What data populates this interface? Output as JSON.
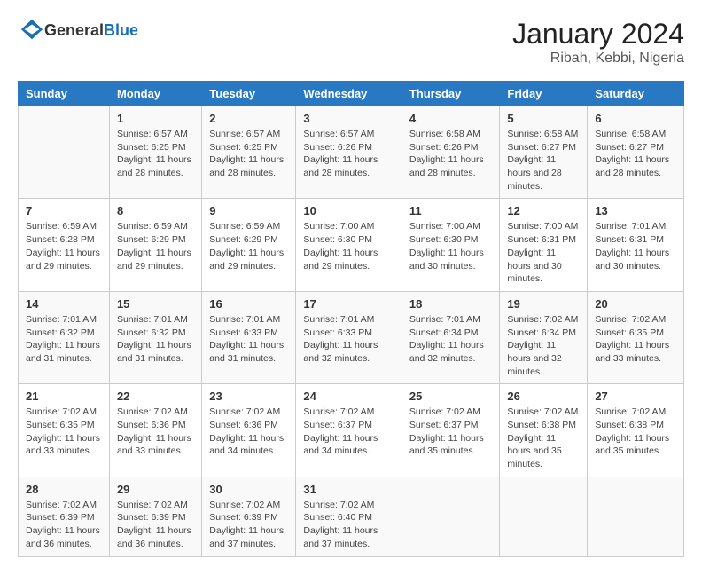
{
  "logo": {
    "text_general": "General",
    "text_blue": "Blue"
  },
  "title": "January 2024",
  "subtitle": "Ribah, Kebbi, Nigeria",
  "days_of_week": [
    "Sunday",
    "Monday",
    "Tuesday",
    "Wednesday",
    "Thursday",
    "Friday",
    "Saturday"
  ],
  "weeks": [
    [
      {
        "day": "",
        "sunrise": "",
        "sunset": "",
        "daylight": ""
      },
      {
        "day": "1",
        "sunrise": "Sunrise: 6:57 AM",
        "sunset": "Sunset: 6:25 PM",
        "daylight": "Daylight: 11 hours and 28 minutes."
      },
      {
        "day": "2",
        "sunrise": "Sunrise: 6:57 AM",
        "sunset": "Sunset: 6:25 PM",
        "daylight": "Daylight: 11 hours and 28 minutes."
      },
      {
        "day": "3",
        "sunrise": "Sunrise: 6:57 AM",
        "sunset": "Sunset: 6:26 PM",
        "daylight": "Daylight: 11 hours and 28 minutes."
      },
      {
        "day": "4",
        "sunrise": "Sunrise: 6:58 AM",
        "sunset": "Sunset: 6:26 PM",
        "daylight": "Daylight: 11 hours and 28 minutes."
      },
      {
        "day": "5",
        "sunrise": "Sunrise: 6:58 AM",
        "sunset": "Sunset: 6:27 PM",
        "daylight": "Daylight: 11 hours and 28 minutes."
      },
      {
        "day": "6",
        "sunrise": "Sunrise: 6:58 AM",
        "sunset": "Sunset: 6:27 PM",
        "daylight": "Daylight: 11 hours and 28 minutes."
      }
    ],
    [
      {
        "day": "7",
        "sunrise": "Sunrise: 6:59 AM",
        "sunset": "Sunset: 6:28 PM",
        "daylight": "Daylight: 11 hours and 29 minutes."
      },
      {
        "day": "8",
        "sunrise": "Sunrise: 6:59 AM",
        "sunset": "Sunset: 6:29 PM",
        "daylight": "Daylight: 11 hours and 29 minutes."
      },
      {
        "day": "9",
        "sunrise": "Sunrise: 6:59 AM",
        "sunset": "Sunset: 6:29 PM",
        "daylight": "Daylight: 11 hours and 29 minutes."
      },
      {
        "day": "10",
        "sunrise": "Sunrise: 7:00 AM",
        "sunset": "Sunset: 6:30 PM",
        "daylight": "Daylight: 11 hours and 29 minutes."
      },
      {
        "day": "11",
        "sunrise": "Sunrise: 7:00 AM",
        "sunset": "Sunset: 6:30 PM",
        "daylight": "Daylight: 11 hours and 30 minutes."
      },
      {
        "day": "12",
        "sunrise": "Sunrise: 7:00 AM",
        "sunset": "Sunset: 6:31 PM",
        "daylight": "Daylight: 11 hours and 30 minutes."
      },
      {
        "day": "13",
        "sunrise": "Sunrise: 7:01 AM",
        "sunset": "Sunset: 6:31 PM",
        "daylight": "Daylight: 11 hours and 30 minutes."
      }
    ],
    [
      {
        "day": "14",
        "sunrise": "Sunrise: 7:01 AM",
        "sunset": "Sunset: 6:32 PM",
        "daylight": "Daylight: 11 hours and 31 minutes."
      },
      {
        "day": "15",
        "sunrise": "Sunrise: 7:01 AM",
        "sunset": "Sunset: 6:32 PM",
        "daylight": "Daylight: 11 hours and 31 minutes."
      },
      {
        "day": "16",
        "sunrise": "Sunrise: 7:01 AM",
        "sunset": "Sunset: 6:33 PM",
        "daylight": "Daylight: 11 hours and 31 minutes."
      },
      {
        "day": "17",
        "sunrise": "Sunrise: 7:01 AM",
        "sunset": "Sunset: 6:33 PM",
        "daylight": "Daylight: 11 hours and 32 minutes."
      },
      {
        "day": "18",
        "sunrise": "Sunrise: 7:01 AM",
        "sunset": "Sunset: 6:34 PM",
        "daylight": "Daylight: 11 hours and 32 minutes."
      },
      {
        "day": "19",
        "sunrise": "Sunrise: 7:02 AM",
        "sunset": "Sunset: 6:34 PM",
        "daylight": "Daylight: 11 hours and 32 minutes."
      },
      {
        "day": "20",
        "sunrise": "Sunrise: 7:02 AM",
        "sunset": "Sunset: 6:35 PM",
        "daylight": "Daylight: 11 hours and 33 minutes."
      }
    ],
    [
      {
        "day": "21",
        "sunrise": "Sunrise: 7:02 AM",
        "sunset": "Sunset: 6:35 PM",
        "daylight": "Daylight: 11 hours and 33 minutes."
      },
      {
        "day": "22",
        "sunrise": "Sunrise: 7:02 AM",
        "sunset": "Sunset: 6:36 PM",
        "daylight": "Daylight: 11 hours and 33 minutes."
      },
      {
        "day": "23",
        "sunrise": "Sunrise: 7:02 AM",
        "sunset": "Sunset: 6:36 PM",
        "daylight": "Daylight: 11 hours and 34 minutes."
      },
      {
        "day": "24",
        "sunrise": "Sunrise: 7:02 AM",
        "sunset": "Sunset: 6:37 PM",
        "daylight": "Daylight: 11 hours and 34 minutes."
      },
      {
        "day": "25",
        "sunrise": "Sunrise: 7:02 AM",
        "sunset": "Sunset: 6:37 PM",
        "daylight": "Daylight: 11 hours and 35 minutes."
      },
      {
        "day": "26",
        "sunrise": "Sunrise: 7:02 AM",
        "sunset": "Sunset: 6:38 PM",
        "daylight": "Daylight: 11 hours and 35 minutes."
      },
      {
        "day": "27",
        "sunrise": "Sunrise: 7:02 AM",
        "sunset": "Sunset: 6:38 PM",
        "daylight": "Daylight: 11 hours and 35 minutes."
      }
    ],
    [
      {
        "day": "28",
        "sunrise": "Sunrise: 7:02 AM",
        "sunset": "Sunset: 6:39 PM",
        "daylight": "Daylight: 11 hours and 36 minutes."
      },
      {
        "day": "29",
        "sunrise": "Sunrise: 7:02 AM",
        "sunset": "Sunset: 6:39 PM",
        "daylight": "Daylight: 11 hours and 36 minutes."
      },
      {
        "day": "30",
        "sunrise": "Sunrise: 7:02 AM",
        "sunset": "Sunset: 6:39 PM",
        "daylight": "Daylight: 11 hours and 37 minutes."
      },
      {
        "day": "31",
        "sunrise": "Sunrise: 7:02 AM",
        "sunset": "Sunset: 6:40 PM",
        "daylight": "Daylight: 11 hours and 37 minutes."
      },
      {
        "day": "",
        "sunrise": "",
        "sunset": "",
        "daylight": ""
      },
      {
        "day": "",
        "sunrise": "",
        "sunset": "",
        "daylight": ""
      },
      {
        "day": "",
        "sunrise": "",
        "sunset": "",
        "daylight": ""
      }
    ]
  ]
}
